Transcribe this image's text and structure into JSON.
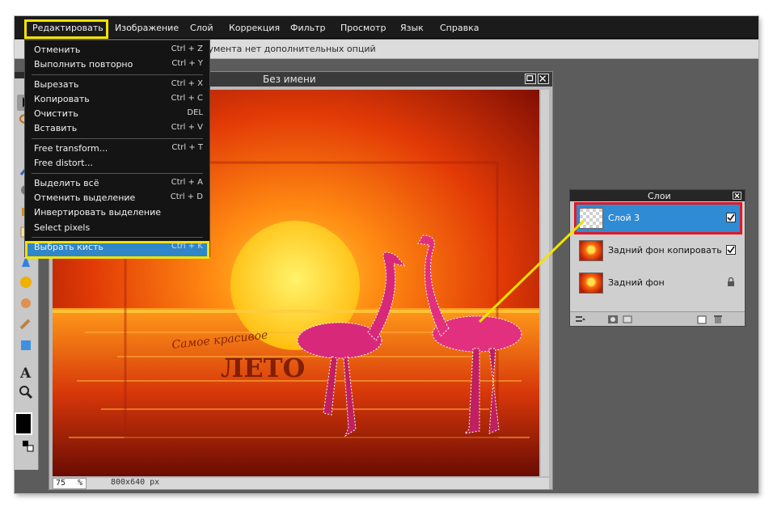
{
  "menubar": {
    "items": [
      "Редактировать",
      "Изображение",
      "Слой",
      "Коррекция",
      "Фильтр",
      "Просмотр",
      "Язык",
      "Справка"
    ]
  },
  "options_bar": {
    "text": "струмента нет дополнительных опций"
  },
  "edit_menu": {
    "items": [
      {
        "label": "Отменить",
        "shortcut": "Ctrl + Z"
      },
      {
        "label": "Выполнить повторно",
        "shortcut": "Ctrl + Y"
      },
      {
        "label": "Вырезать",
        "shortcut": "Ctrl + X"
      },
      {
        "label": "Копировать",
        "shortcut": "Ctrl + C"
      },
      {
        "label": "Очистить",
        "shortcut": "DEL"
      },
      {
        "label": "Вставить",
        "shortcut": "Ctrl + V"
      },
      {
        "label": "Free transform...",
        "shortcut": "Ctrl + T"
      },
      {
        "label": "Free distort...",
        "shortcut": ""
      },
      {
        "label": "Выделить всё",
        "shortcut": "Ctrl + A"
      },
      {
        "label": "Отменить выделение",
        "shortcut": "Ctrl + D"
      },
      {
        "label": "Инвертировать выделение",
        "shortcut": ""
      },
      {
        "label": "Select pixels",
        "shortcut": ""
      },
      {
        "label": "Выбрать кисть",
        "shortcut": "Ctrl + K"
      }
    ]
  },
  "document": {
    "title": "Без имени",
    "zoom": "75",
    "zoom_unit": "%",
    "size": "800x640 px",
    "artwork_text": [
      "Самое красивое",
      "ЛЕТО"
    ]
  },
  "layers_panel": {
    "title": "Слои",
    "layers": [
      {
        "name": "Слой 3",
        "visible": true,
        "active": true
      },
      {
        "name": "Задний фон копировать",
        "visible": true,
        "active": false
      },
      {
        "name": "Задний фон",
        "visible": false,
        "locked": true,
        "active": false
      }
    ]
  },
  "colors": {
    "highlight": "#f2e200",
    "active_layer": "#2f8bd3",
    "active_layer_outline": "#e11826",
    "menubar": "#1b1b1b",
    "workspace": "#5c5c5c"
  },
  "icons": [
    "move-icon",
    "lasso-icon",
    "text-icon",
    "zoom-icon",
    "close-icon",
    "maximize-icon",
    "checkbox-icon",
    "lock-icon",
    "new-layer-icon",
    "delete-layer-icon"
  ]
}
